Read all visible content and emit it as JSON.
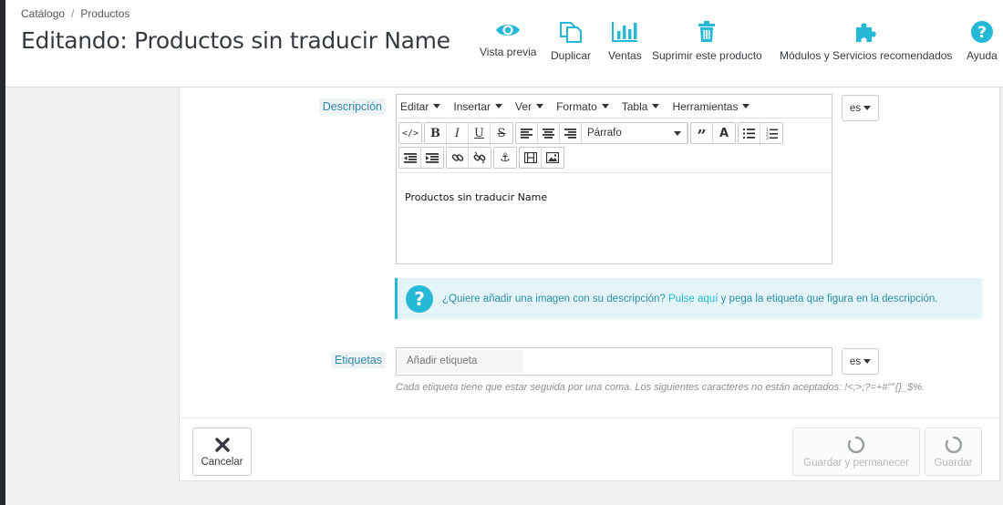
{
  "breadcrumb": {
    "first": "Catálogo",
    "separator": "/",
    "second": "Productos"
  },
  "page_title": "Editando: Productos sin traducir Name",
  "toolbar": [
    {
      "label": "Vista previa",
      "icon": "eye-icon"
    },
    {
      "label": "Duplicar",
      "icon": "copy-icon"
    },
    {
      "label": "Ventas",
      "icon": "bar-chart-icon"
    },
    {
      "label": "Suprimir este producto",
      "icon": "trash-icon"
    },
    {
      "label": "Módulos y Servicios recomendados",
      "icon": "puzzle-icon"
    },
    {
      "label": "Ayuda",
      "icon": "help-circle-icon"
    }
  ],
  "description": {
    "label": "Descripción",
    "menu": [
      "Editar",
      "Insertar",
      "Ver",
      "Formato",
      "Tabla",
      "Herramientas"
    ],
    "format_value": "Párrafo",
    "content": "Productos sin traducir Name",
    "lang": "es"
  },
  "alert": {
    "text_before": "¿Quiere añadir una imagen con su descripción?",
    "link": "Pulse aquí",
    "text_after": "y pega la etiqueta que figura en la descripción."
  },
  "tags": {
    "label": "Etiquetas",
    "placeholder": "Añadir etiqueta",
    "lang": "es",
    "help": "Cada etiqueta tiene que estar seguida por una coma. Los siguientes caracteres no están aceptados: !<;>;?=+#\"°{}_$%."
  },
  "footer": {
    "cancel": "Cancelar",
    "save_stay": "Guardar y permanecer",
    "save": "Guardar"
  },
  "colors": {
    "accent": "#25b9d7",
    "label": "#3189ac",
    "title": "#363a41"
  }
}
